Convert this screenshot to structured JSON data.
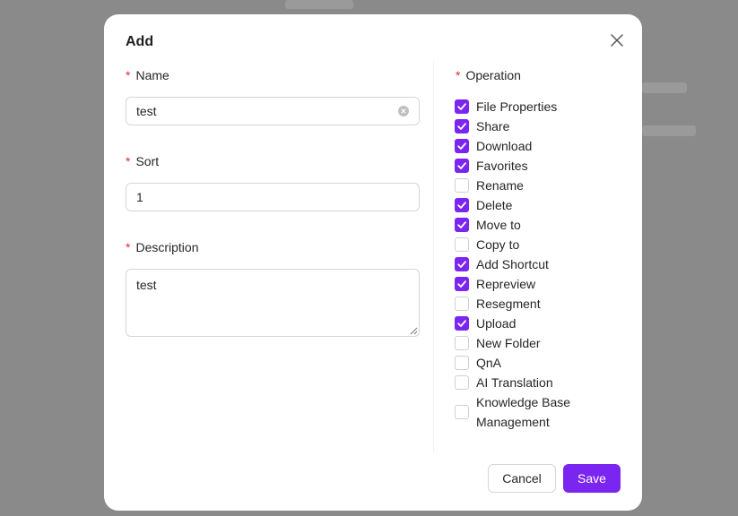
{
  "dialog": {
    "title": "Add",
    "name": {
      "label": "Name",
      "value": "test"
    },
    "sort": {
      "label": "Sort",
      "value": "1"
    },
    "description": {
      "label": "Description",
      "value": "test"
    },
    "operation": {
      "label": "Operation",
      "items": [
        {
          "label": "File Properties",
          "checked": true
        },
        {
          "label": "Share",
          "checked": true
        },
        {
          "label": "Download",
          "checked": true
        },
        {
          "label": "Favorites",
          "checked": true
        },
        {
          "label": "Rename",
          "checked": false
        },
        {
          "label": "Delete",
          "checked": true
        },
        {
          "label": "Move to",
          "checked": true
        },
        {
          "label": "Copy to",
          "checked": false
        },
        {
          "label": "Add Shortcut",
          "checked": true
        },
        {
          "label": "Repreview",
          "checked": true
        },
        {
          "label": "Resegment",
          "checked": false
        },
        {
          "label": "Upload",
          "checked": true
        },
        {
          "label": "New Folder",
          "checked": false
        },
        {
          "label": "QnA",
          "checked": false
        },
        {
          "label": "AI Translation",
          "checked": false
        },
        {
          "label": "Knowledge Base Management",
          "checked": false
        }
      ]
    },
    "buttons": {
      "cancel": "Cancel",
      "save": "Save"
    }
  },
  "colors": {
    "accent": "#7b25f0",
    "required": "#e02d2d",
    "overlay": "#8a8a8a"
  },
  "icons": {
    "close": "close-icon",
    "clear": "clear-circle-icon",
    "check": "check-icon"
  }
}
